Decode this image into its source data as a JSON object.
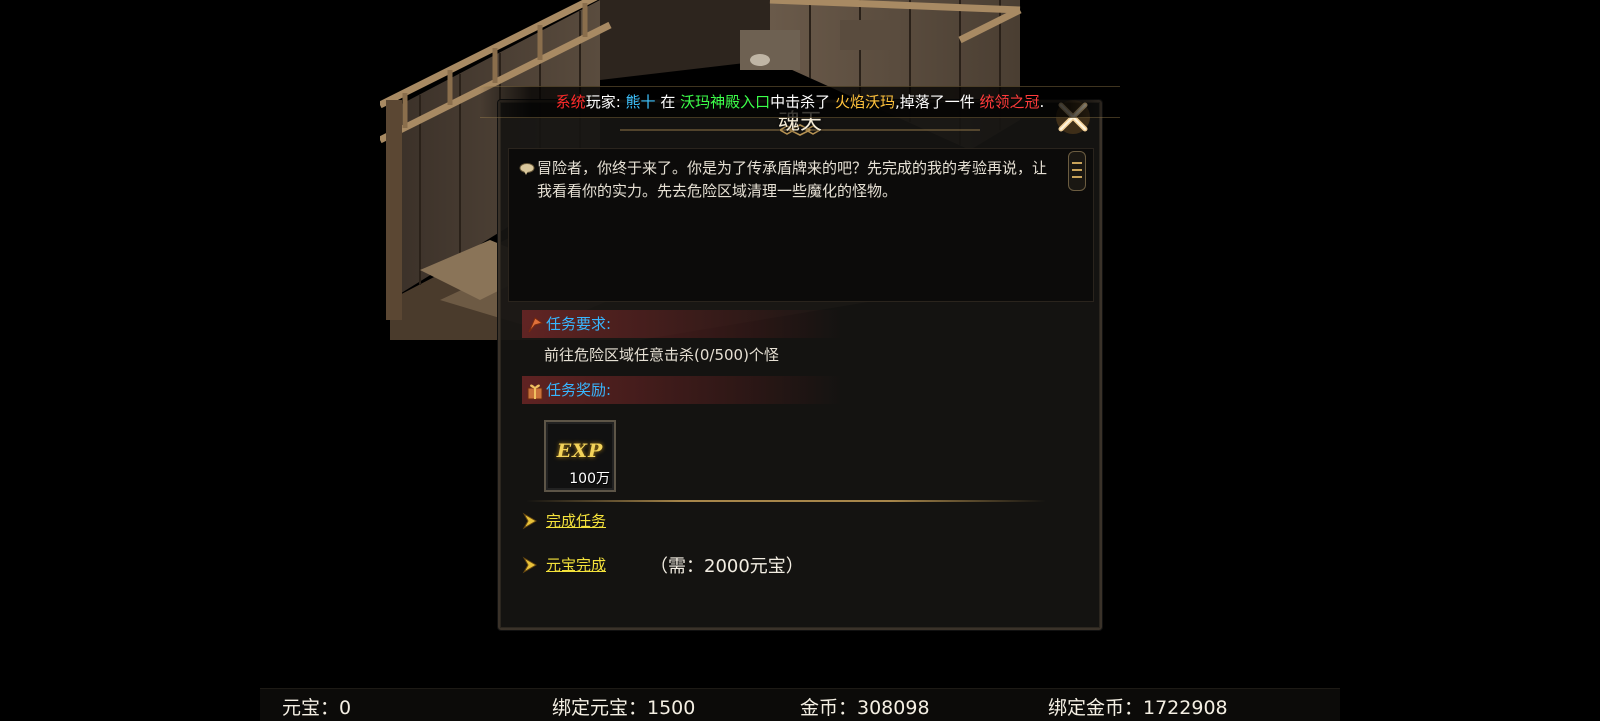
{
  "broadcast": {
    "system": "系统",
    "player_label": "玩家:",
    "player": "熊十",
    "at": "在",
    "location": "沃玛神殿入口",
    "kill_text": "中击杀了",
    "monster": "火焰沃玛",
    "drop_text": ",掉落了一件",
    "item": "统领之冠",
    "end": "."
  },
  "dialog": {
    "title": "魂天",
    "npc_text": "冒险者，你终于来了。你是为了传承盾牌来的吧？先完成的我的考验再说，让我看看你的实力。先去危险区域清理一些魔化的怪物。",
    "requirement_label": "任务要求:",
    "requirement_text": "前往危险区域任意击杀(0/500)个怪",
    "reward_label": "任务奖励:",
    "reward": {
      "icon_text": "EXP",
      "quantity": "100万"
    },
    "complete_link": "完成任务",
    "gold_complete_link": "元宝完成",
    "gold_cost": "（需：2000元宝）"
  },
  "currency": {
    "yuanbao": "元宝：0",
    "bound_yuanbao": "绑定元宝：1500",
    "gold": "金币：308098",
    "bound_gold": "绑定金币：1722908"
  },
  "colors": {
    "system": "#ff2b2b",
    "player": "#3ec3ff",
    "location": "#3cff4a",
    "monster": "#ffc23c",
    "item": "#ff3b3b",
    "section_label": "#38b6ff",
    "link": "#f4e23b"
  }
}
